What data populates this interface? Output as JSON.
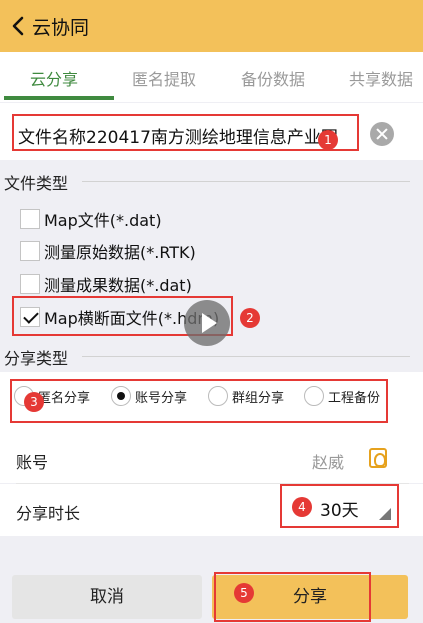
{
  "header": {
    "title": "云协同",
    "back_icon": "chevron-left-icon"
  },
  "tabs": [
    {
      "label": "云分享",
      "active": true
    },
    {
      "label": "匿名提取",
      "active": false
    },
    {
      "label": "备份数据",
      "active": false
    },
    {
      "label": "共享数据",
      "active": false
    }
  ],
  "file": {
    "name_value": "文件名称220417南方测绘地理信息产业园"
  },
  "file_type": {
    "title": "文件类型",
    "options": [
      {
        "label": "Map文件(*.dat)",
        "checked": false
      },
      {
        "label": "测量原始数据(*.RTK)",
        "checked": false
      },
      {
        "label": "测量成果数据(*.dat)",
        "checked": false
      },
      {
        "label": "Map横断面文件(*.hdm)",
        "checked": true
      }
    ]
  },
  "share_type": {
    "title": "分享类型",
    "options": [
      {
        "label": "匿名分享",
        "selected": false
      },
      {
        "label": "账号分享",
        "selected": true
      },
      {
        "label": "群组分享",
        "selected": false
      },
      {
        "label": "工程备份",
        "selected": false
      }
    ]
  },
  "account": {
    "label": "账号",
    "value": "赵威"
  },
  "duration": {
    "label": "分享时长",
    "value": "30天"
  },
  "buttons": {
    "cancel": "取消",
    "share": "分享"
  },
  "annotations": [
    "1",
    "2",
    "3",
    "4",
    "5"
  ],
  "colors": {
    "header": "#f3c15a",
    "accent_green": "#3f8a3f",
    "annotation_red": "#e53935"
  }
}
